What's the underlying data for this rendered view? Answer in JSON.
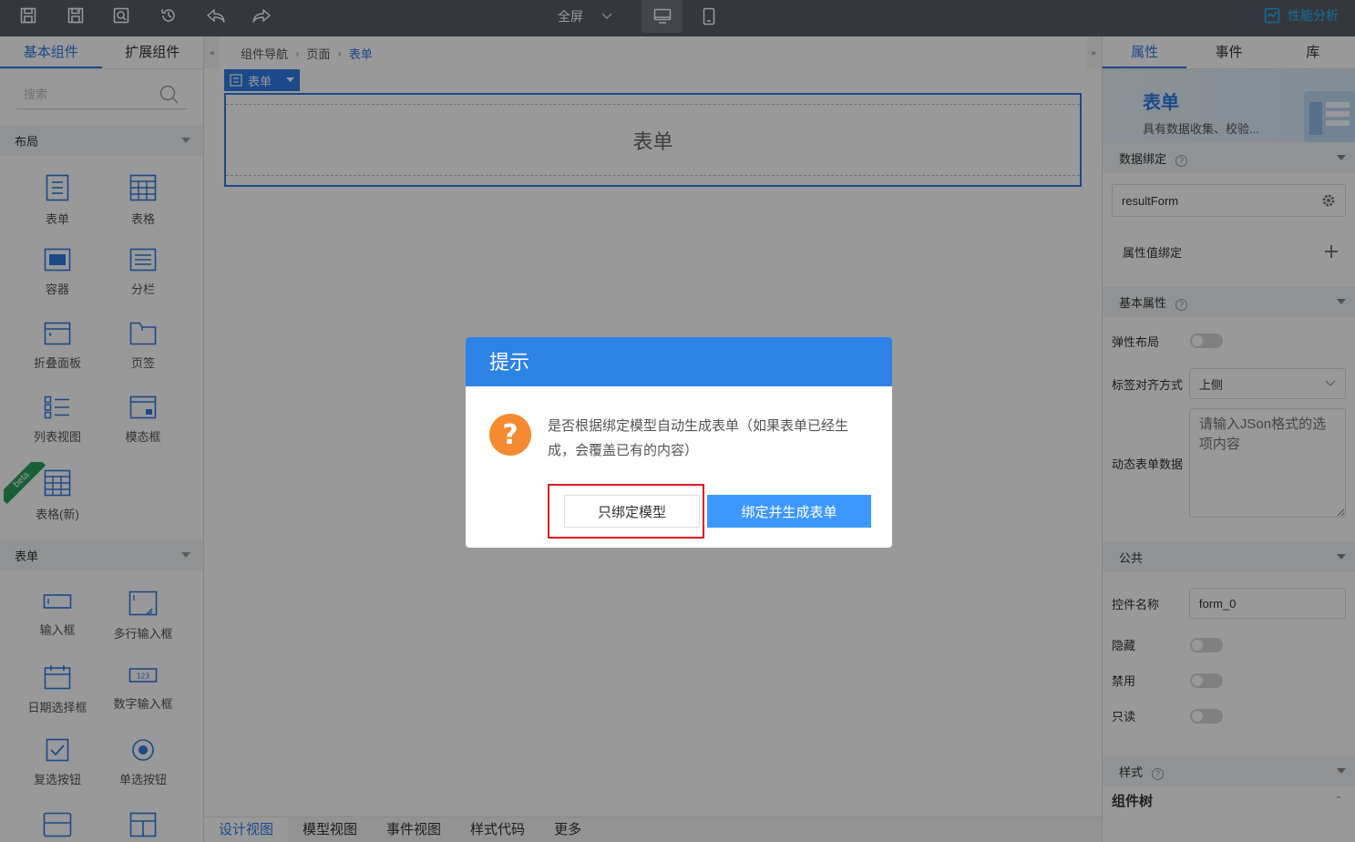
{
  "toolbar": {
    "fullscreen_label": "全屏",
    "perf_label": "性能分析"
  },
  "left_panel": {
    "tabs": [
      "基本组件",
      "扩展组件"
    ],
    "search_placeholder": "搜索",
    "sections": [
      {
        "title": "布局",
        "items": [
          {
            "label": "表单",
            "icon": "form-icon"
          },
          {
            "label": "表格",
            "icon": "table-icon"
          },
          {
            "label": "容器",
            "icon": "container-icon"
          },
          {
            "label": "分栏",
            "icon": "columns-icon"
          },
          {
            "label": "折叠面板",
            "icon": "collapse-panel-icon"
          },
          {
            "label": "页签",
            "icon": "folder-tab-icon"
          },
          {
            "label": "列表视图",
            "icon": "list-view-icon"
          },
          {
            "label": "模态框",
            "icon": "modal-icon"
          },
          {
            "label": "表格(新)",
            "icon": "table-new-icon",
            "badge": "beta"
          }
        ]
      },
      {
        "title": "表单",
        "items": [
          {
            "label": "输入框",
            "icon": "input-icon"
          },
          {
            "label": "多行输入框",
            "icon": "textarea-icon"
          },
          {
            "label": "日期选择框",
            "icon": "calendar-icon"
          },
          {
            "label": "数字输入框",
            "icon": "number-input-icon"
          },
          {
            "label": "复选按钮",
            "icon": "checkbox-icon"
          },
          {
            "label": "单选按钮",
            "icon": "radio-icon"
          }
        ]
      }
    ]
  },
  "center": {
    "breadcrumb": [
      "组件导航",
      "页面",
      "表单"
    ],
    "form_tag": "表单",
    "form_placeholder": "表单",
    "bottom_tabs": [
      "设计视图",
      "模型视图",
      "事件视图",
      "样式代码",
      "更多"
    ]
  },
  "right_panel": {
    "tabs": [
      "属性",
      "事件",
      "库"
    ],
    "header_title": "表单",
    "header_desc": "具有数据收集、校验...",
    "sections": {
      "data_binding": "数据绑定",
      "basic_props": "基本属性",
      "public": "公共",
      "style": "样式",
      "component_tree": "组件树"
    },
    "binding_value": "resultForm",
    "attr_binding_label": "属性值绑定",
    "elastic_label": "弹性布局",
    "label_align_label": "标签对齐方式",
    "label_align_value": "上侧",
    "dynamic_data_label": "动态表单数据",
    "dynamic_data_placeholder": "请输入JSon格式的选项内容",
    "control_name_label": "控件名称",
    "control_name_value": "form_0",
    "hidden_label": "隐藏",
    "disabled_label": "禁用",
    "readonly_label": "只读"
  },
  "dialog": {
    "title": "提示",
    "message": "是否根据绑定模型自动生成表单（如果表单已经生成，会覆盖已有的内容）",
    "btn_bind_only": "只绑定模型",
    "btn_bind_generate": "绑定并生成表单",
    "icon": "question-icon",
    "accent": "#2d82e6",
    "icon_color": "#f58b30"
  }
}
